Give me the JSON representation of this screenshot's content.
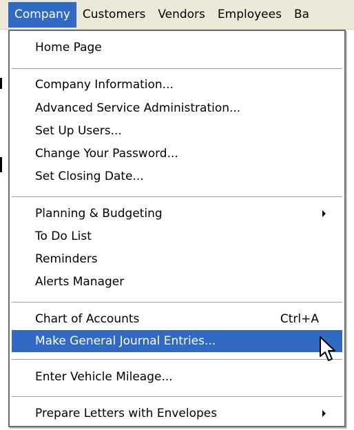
{
  "menubar": {
    "items": [
      {
        "label": "Company",
        "active": true
      },
      {
        "label": "Customers",
        "active": false
      },
      {
        "label": "Vendors",
        "active": false
      },
      {
        "label": "Employees",
        "active": false
      },
      {
        "label": "Ba",
        "active": false
      }
    ]
  },
  "dropdown": {
    "groups": [
      {
        "items": [
          {
            "label": "Home Page"
          }
        ]
      },
      {
        "items": [
          {
            "label": "Company Information..."
          },
          {
            "label": "Advanced Service Administration..."
          },
          {
            "label": "Set Up Users..."
          },
          {
            "label": "Change Your Password..."
          },
          {
            "label": "Set Closing Date..."
          }
        ]
      },
      {
        "items": [
          {
            "label": "Planning & Budgeting",
            "submenu": true
          },
          {
            "label": "To Do List"
          },
          {
            "label": "Reminders"
          },
          {
            "label": "Alerts Manager"
          }
        ]
      },
      {
        "items": [
          {
            "label": "Chart of Accounts",
            "shortcut": "Ctrl+A"
          },
          {
            "label": "Make General Journal Entries...",
            "highlighted": true
          }
        ]
      },
      {
        "items": [
          {
            "label": "Enter Vehicle Mileage..."
          }
        ]
      },
      {
        "items": [
          {
            "label": "Prepare Letters with Envelopes",
            "submenu": true
          }
        ]
      }
    ]
  },
  "colors": {
    "highlight": "#316ac5",
    "menubar_bg": "#ece9d8",
    "text": "#000000"
  },
  "cursor": {
    "icon": "arrow-pointer-icon"
  }
}
